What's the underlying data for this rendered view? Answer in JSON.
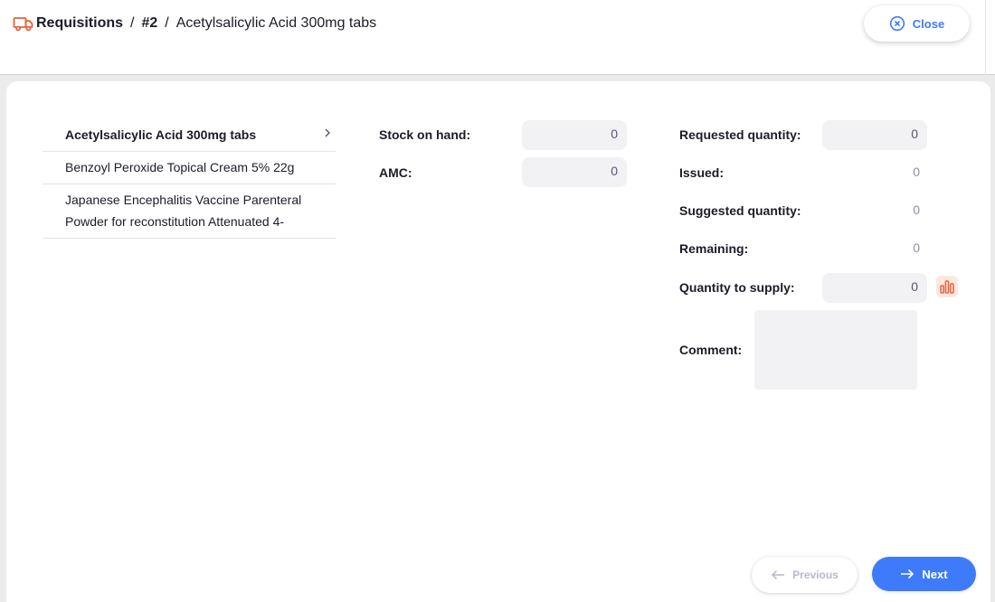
{
  "breadcrumb": {
    "icon": "truck-icon",
    "root": "Requisitions",
    "separator": "/",
    "number": "#2",
    "item": "Acetylsalicylic Acid 300mg tabs"
  },
  "header": {
    "close_label": "Close",
    "close_icon": "close-circle-icon"
  },
  "items": [
    {
      "name": "Acetylsalicylic Acid 300mg tabs",
      "selected": true
    },
    {
      "name": "Benzoyl Peroxide Topical Cream 5% 22g",
      "selected": false
    },
    {
      "name": "Japanese Encephalitis Vaccine Parenteral Powder for reconstitution Attenuated 4-",
      "selected": false
    }
  ],
  "fields": {
    "stock_on_hand": {
      "label": "Stock on hand:",
      "value": "0"
    },
    "amc": {
      "label": "AMC:",
      "value": "0"
    },
    "requested_quantity": {
      "label": "Requested quantity:",
      "value": "0"
    },
    "issued": {
      "label": "Issued:",
      "value": "0"
    },
    "suggested_quantity": {
      "label": "Suggested quantity:",
      "value": "0"
    },
    "remaining": {
      "label": "Remaining:",
      "value": "0"
    },
    "quantity_to_supply": {
      "label": "Quantity to supply:",
      "value": "0"
    },
    "comment": {
      "label": "Comment:",
      "value": ""
    }
  },
  "footer": {
    "previous_label": "Previous",
    "next_label": "Next"
  },
  "colors": {
    "accent": "#3e7bfa",
    "brand_icon": "#e8623a",
    "disabled_text": "#b8b9c8"
  }
}
